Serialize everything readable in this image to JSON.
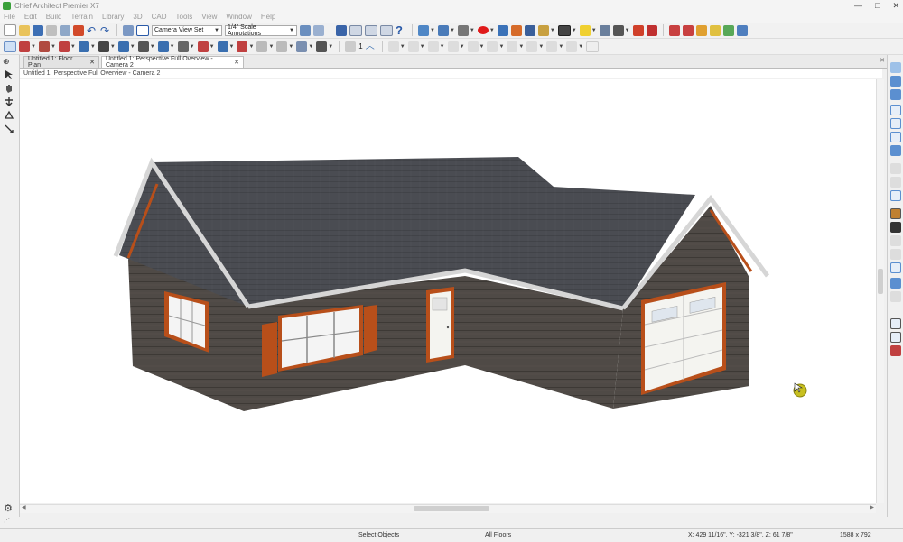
{
  "window": {
    "title": "Chief Architect Premier X7",
    "minimize": "—",
    "maximize": "□",
    "close": "✕"
  },
  "menu": [
    "File",
    "Edit",
    "Build",
    "Terrain",
    "Library",
    "3D",
    "CAD",
    "Tools",
    "View",
    "Window",
    "Help"
  ],
  "toolbar": {
    "camera_view_set": "Camera View Set",
    "annotation_set": "1/4\" Scale Annotations",
    "layer_count": "1"
  },
  "tabs": [
    {
      "label": "Untitled 1: Floor Plan",
      "close": "✕",
      "active": false
    },
    {
      "label": "Untitled 1: Perspective Full Overview - Camera 2",
      "close": "✕",
      "active": true
    }
  ],
  "view": {
    "header": "Untitled 1: Perspective Full Overview - Camera 2"
  },
  "status": {
    "mode": "Select Objects",
    "floor": "All Floors",
    "coords": "X: 429 11/16\", Y: -321 3/8\", Z: 61 7/8\"",
    "resolution": "1588 x 792"
  },
  "colors": {
    "roof": "#4a4c52",
    "siding": "#4f4a46",
    "trim": "#b84f1a",
    "fascia": "#d6d6d6",
    "door": "#f4f4f0",
    "cursor": "#c8c020"
  }
}
